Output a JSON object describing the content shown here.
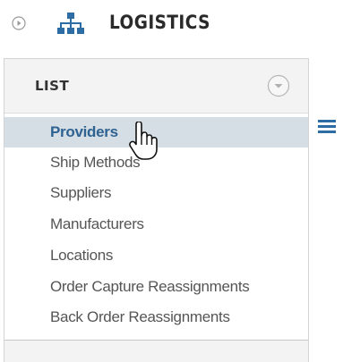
{
  "header": {
    "title": "LOGISTICS",
    "play_icon": "play-circle-icon",
    "logo_icon": "org-tree-icon"
  },
  "panel": {
    "title": "LIST",
    "toggle_icon": "chevron-down-circle-icon",
    "items": [
      {
        "label": "Providers",
        "selected": true
      },
      {
        "label": "Ship Methods",
        "selected": false
      },
      {
        "label": "Suppliers",
        "selected": false
      },
      {
        "label": "Manufacturers",
        "selected": false
      },
      {
        "label": "Locations",
        "selected": false
      },
      {
        "label": "Order Capture Reassignments",
        "selected": false
      },
      {
        "label": "Back Order Reassignments",
        "selected": false
      }
    ]
  },
  "side": {
    "menu_icon": "hamburger-menu-icon"
  },
  "colors": {
    "accent_blue": "#2e6da4",
    "selected_bg": "#d5dde5",
    "selected_text": "#2e6291",
    "panel_bg": "#f3f3f3",
    "item_text": "#555555"
  },
  "cursor_icon": "hand-pointer-icon"
}
